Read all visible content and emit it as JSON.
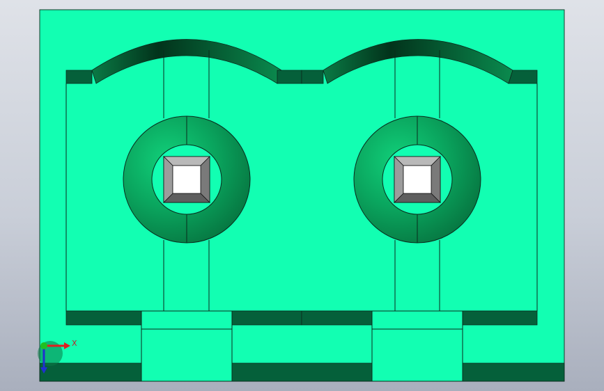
{
  "viewport": {
    "model": {
      "face_color": "#12ffb2",
      "edge_color": "#0a2a1c",
      "shadow_color": "#056034",
      "ring_color": "#0f9e55",
      "hole_wall_color": "#8b8b8b",
      "hole_floor_color": "#ffffff"
    },
    "triad": {
      "x_label": "X",
      "x_color": "#e02020",
      "y_color": "#20c020",
      "z_color": "#2030d0"
    }
  }
}
